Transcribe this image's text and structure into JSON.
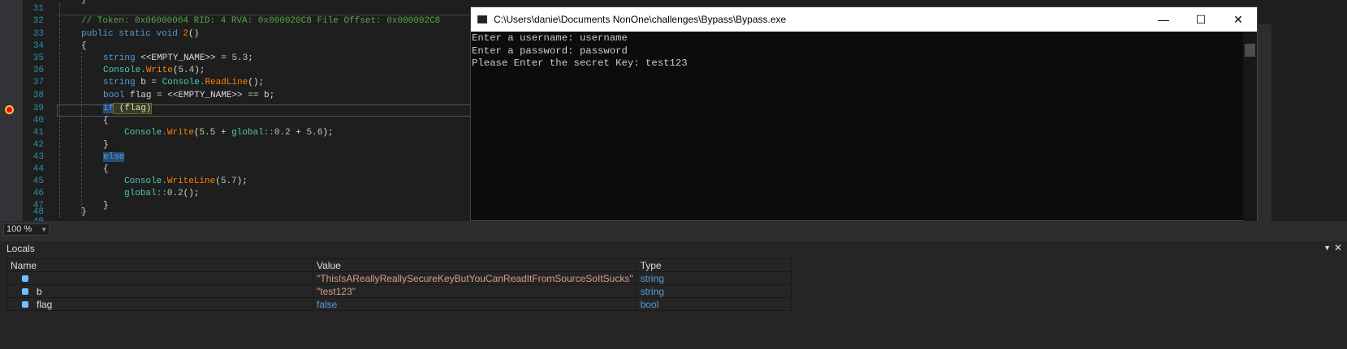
{
  "editor": {
    "line_numbers": [
      "31",
      "32",
      "33",
      "34",
      "35",
      "36",
      "37",
      "38",
      "39",
      "40",
      "41",
      "42",
      "43",
      "44",
      "45",
      "46",
      "47",
      "48",
      "49"
    ],
    "lines": {
      "l32": "// Token: 0x06000004 RID: 4 RVA: 0x000020C8 File Offset: 0x000002C8",
      "l33a": "public static void ",
      "l33b": "2",
      "l33c": "()",
      "l35a": "string ",
      "l35b": "<<EMPTY_NAME>> = ",
      "l35c": "5.3",
      ";": ";",
      "l36a": "Console.",
      "l36b": "Write",
      "l36c": "(",
      "l36d": "5.4",
      "l36e": ");",
      "l37a": "string ",
      "l37b": "b = ",
      "l37c": "Console.",
      "l37d": "ReadLine",
      "l37e": "();",
      "l38a": "bool ",
      "l38b": "flag = <<EMPTY_NAME>> == b;",
      "l39a": "if",
      "l39b": " (flag)",
      "l41a": "Console.",
      "l41b": "Write",
      "l41c": "(",
      "l41d": "5.5",
      " l41e": " + ",
      "l41f": "global::",
      "l41g": "0.2",
      " l41h": " + ",
      "l41i": "5.6",
      "l41j": ");",
      "l43": "else",
      "l45a": "Console.",
      "l45b": "WriteLine",
      "l45c": "(",
      "l45d": "5.7",
      "l45e": ");",
      "l46a": "global::",
      "l46b": "0.2",
      "l46c": "();",
      "ob": "{",
      "cb": "}"
    }
  },
  "console": {
    "title": "C:\\Users\\danie\\Documents NonOne\\challenges\\Bypass\\Bypass.exe",
    "text": "Enter a username: username\nEnter a password: password\nPlease Enter the secret Key: test123"
  },
  "zoom": "100 %",
  "locals": {
    "title": "Locals",
    "headers": [
      "Name",
      "Value",
      "Type"
    ],
    "rows": [
      {
        "name": "",
        "value": "\"ThisIsAReallyReallySecureKeyButYouCanReadItFromSourceSoItSucks\"",
        "type": "string"
      },
      {
        "name": "b",
        "value": "\"test123\"",
        "type": "string"
      },
      {
        "name": "flag",
        "value": "false",
        "type": "bool"
      }
    ]
  }
}
